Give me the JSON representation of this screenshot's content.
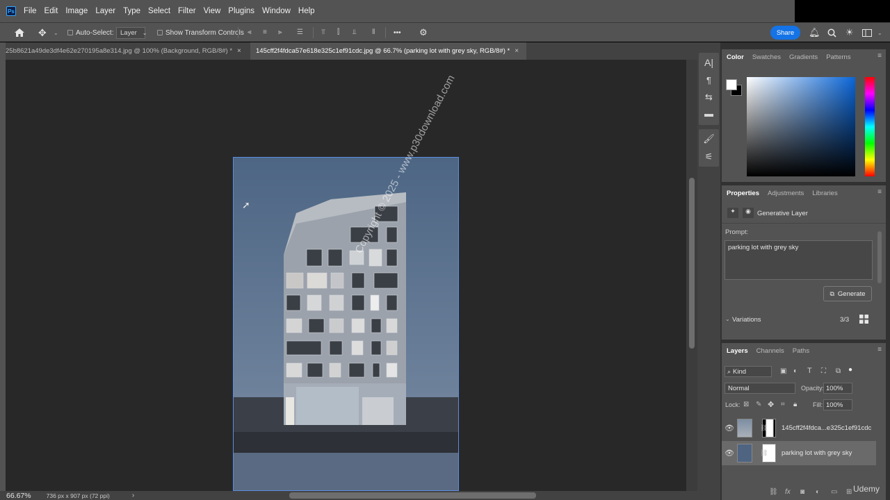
{
  "app": {
    "logo": "Ps",
    "menu": [
      "File",
      "Edit",
      "Image",
      "Layer",
      "Type",
      "Select",
      "Filter",
      "View",
      "Plugins",
      "Window",
      "Help"
    ]
  },
  "options": {
    "auto_select_label": "Auto-Select:",
    "layer_select_value": "Layer",
    "show_transform_label": "Show Transform Controls",
    "more_label": "•••",
    "share_label": "Share"
  },
  "tabs": [
    {
      "label": "25b8621a49de3df4e62e270195a8e314.jpg @ 100% (Background, RGB/8#) *",
      "close": "×"
    },
    {
      "label": "145cff2f4fdca57e618e325c1ef91cdc.jpg @ 66.7% (parking lot with grey sky, RGB/8#) *",
      "close": "×"
    }
  ],
  "canvas": {
    "watermark": "Copyright © 2025 - www.p30download.com"
  },
  "status": {
    "zoom": "66.67%",
    "doc_info": "736 px x 907 px (72 ppi)",
    "arrow": "›"
  },
  "color_panel": {
    "tabs": [
      "Color",
      "Swatches",
      "Gradients",
      "Patterns"
    ]
  },
  "properties_panel": {
    "tabs": [
      "Properties",
      "Adjustments",
      "Libraries"
    ],
    "layer_type": "Generative Layer",
    "prompt_label": "Prompt:",
    "prompt_value": "parking lot with grey sky",
    "generate_label": "Generate",
    "variations_label": "Variations",
    "variations_count": "3/3"
  },
  "layers_panel": {
    "tabs": [
      "Layers",
      "Channels",
      "Paths"
    ],
    "kind_label": "Kind",
    "blend_mode": "Normal",
    "opacity_label": "Opacity:",
    "opacity_value": "100%",
    "lock_label": "Lock:",
    "fill_label": "Fill:",
    "fill_value": "100%",
    "layers": [
      {
        "name": "145cff2f4fdca...e325c1ef91cdc"
      },
      {
        "name": "parking lot with grey sky"
      }
    ]
  },
  "watermark_brand": "Udemy"
}
